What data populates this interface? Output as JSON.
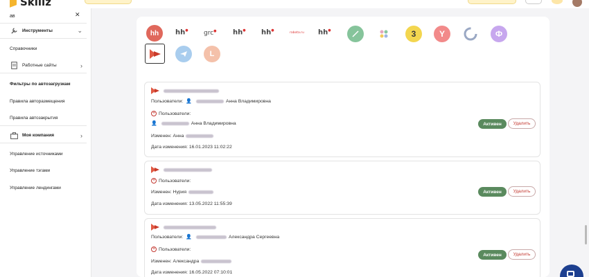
{
  "app": {
    "logo_text": "Skillz"
  },
  "sidebar": {
    "search": {
      "value": "ав",
      "clear_icon": "close-icon"
    },
    "items": [
      {
        "label": "Инструменты",
        "icon": "tools-icon",
        "chevron": "chevron-down-icon"
      },
      {
        "label": "Справочники"
      },
      {
        "label": "Работные сайты",
        "icon": "document-icon",
        "chevron": "chevron-right-icon"
      },
      {
        "label": "Фильтры по автозагрузкам"
      },
      {
        "label": "Правила авторазмещения"
      },
      {
        "label": "Правила автозакрытия"
      },
      {
        "label": "Моя компания",
        "icon": "building-icon",
        "chevron": "chevron-right-icon"
      },
      {
        "label": "Управление источниками"
      },
      {
        "label": "Управление тэгами"
      },
      {
        "label": "Управление лендингами"
      }
    ]
  },
  "sources": {
    "icons": [
      {
        "name": "hh-round",
        "text": "hh",
        "color": "#e55b4d"
      },
      {
        "name": "hh-text-1",
        "text": "hh"
      },
      {
        "name": "grc",
        "text": "grc"
      },
      {
        "name": "hh-text-2",
        "text": "hh"
      },
      {
        "name": "hh-text-3",
        "text": "hh"
      },
      {
        "name": "rabota",
        "text": "rabota.ru"
      },
      {
        "name": "hh-text-4",
        "text": "hh"
      },
      {
        "name": "green-leaf",
        "text": ""
      },
      {
        "name": "dots",
        "text": ""
      },
      {
        "name": "zarplata",
        "text": "3"
      },
      {
        "name": "yandex",
        "text": "Y"
      },
      {
        "name": "circle",
        "text": ""
      },
      {
        "name": "finder",
        "text": "Ф"
      },
      {
        "name": "triangle-logo",
        "text": "",
        "selected": true
      },
      {
        "name": "telegram",
        "text": ""
      },
      {
        "name": "letter-l",
        "text": "L"
      }
    ]
  },
  "cards": [
    {
      "users_label": "Пользователи:",
      "user_name": "Анна Владимировна",
      "users_section": "Пользователи:",
      "member_name": "Анна Владимировна",
      "changed_label": "Изменен:",
      "changed_name": "Анна",
      "date_label": "Дата изменения:",
      "date": "16.01.2023 11:02:22",
      "status": "Активен",
      "delete": "Удалить"
    },
    {
      "users_section": "Пользователи:",
      "changed_label": "Изменен:",
      "changed_name": "Нурия",
      "date_label": "Дата изменения:",
      "date": "13.05.2022 11:55:39",
      "status": "Активен",
      "delete": "Удалить"
    },
    {
      "users_label": "Пользователи:",
      "user_name": "Александра Сергеевна",
      "users_section": "Пользователи:",
      "changed_label": "Изменен:",
      "changed_name": "Александра",
      "date_label": "Дата изменения:",
      "date": "16.05.2022 07:10:01",
      "status": "Активен",
      "delete": "Удалить"
    }
  ],
  "colors": {
    "active_badge": "#5a8a5e",
    "delete_text": "#c3372f",
    "fab": "#1d3f8f"
  }
}
